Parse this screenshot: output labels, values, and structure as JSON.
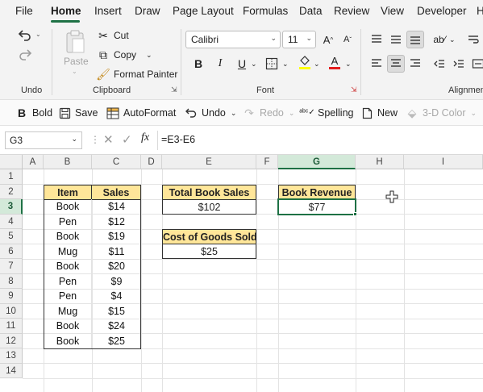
{
  "menu": {
    "items": [
      "File",
      "Home",
      "Insert",
      "Draw",
      "Page Layout",
      "Formulas",
      "Data",
      "Review",
      "View",
      "Developer",
      "H"
    ],
    "active": "Home"
  },
  "ribbon": {
    "undo_group": "Undo",
    "clipboard": {
      "paste": "Paste",
      "cut": "Cut",
      "copy": "Copy",
      "format_painter": "Format Painter",
      "label": "Clipboard"
    },
    "font": {
      "name": "Calibri",
      "size": "11",
      "label": "Font",
      "bold": "B",
      "italic": "I",
      "underline": "U"
    },
    "alignment": {
      "label": "Alignmen"
    }
  },
  "qat": {
    "bold": "Bold",
    "save": "Save",
    "autoformat": "AutoFormat",
    "undo": "Undo",
    "redo": "Redo",
    "spelling": "Spelling",
    "new": "New",
    "color_3d": "3-D Color"
  },
  "formula_bar": {
    "cell_ref": "G3",
    "formula": "=E3-E6",
    "fx": "fx"
  },
  "grid": {
    "columns": [
      "A",
      "B",
      "C",
      "D",
      "E",
      "F",
      "G",
      "H",
      "I"
    ],
    "rows": [
      "1",
      "2",
      "3",
      "4",
      "5",
      "6",
      "7",
      "8",
      "9",
      "10",
      "11",
      "12",
      "13",
      "14"
    ],
    "selected_column": "G",
    "selected_row": "3"
  },
  "sales_table": {
    "headers": [
      "Item",
      "Sales"
    ],
    "rows": [
      [
        "Book",
        "$14"
      ],
      [
        "Pen",
        "$12"
      ],
      [
        "Book",
        "$19"
      ],
      [
        "Mug",
        "$11"
      ],
      [
        "Book",
        "$20"
      ],
      [
        "Pen",
        "$9"
      ],
      [
        "Pen",
        "$4"
      ],
      [
        "Mug",
        "$15"
      ],
      [
        "Book",
        "$24"
      ],
      [
        "Book",
        "$25"
      ]
    ]
  },
  "summary": {
    "total_book_sales_label": "Total Book Sales",
    "total_book_sales_value": "$102",
    "cogs_label": "Cost of Goods Sold",
    "cogs_value": "$25",
    "book_revenue_label": "Book Revenue",
    "book_revenue_value": "$77"
  },
  "colors": {
    "accent": "#1e7145",
    "header_fill": "#ffe699",
    "selected_header": "#d3e9d9"
  }
}
